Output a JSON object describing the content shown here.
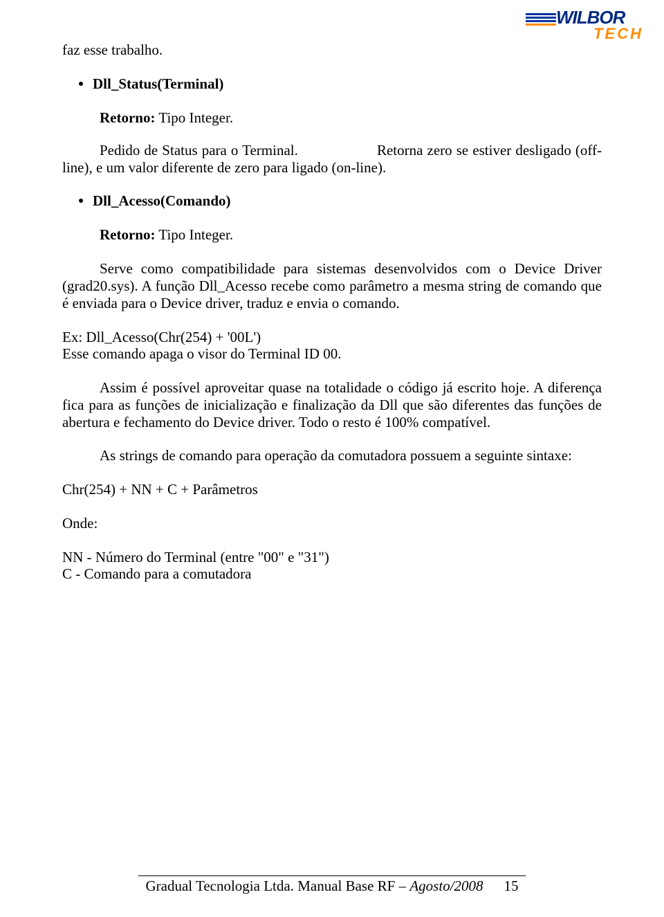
{
  "logo": {
    "brand": "WILBOR",
    "sub": "TECH"
  },
  "p_intro": "faz esse trabalho.",
  "item1": {
    "title": "Dll_Status(Terminal)",
    "retorno_label": "Retorno:",
    "retorno_val": " Tipo  Integer.",
    "desc1": "Pedido de Status para o Terminal.",
    "desc2": "Retorna zero se estiver desligado (off-line), e um valor diferente de zero para ligado (on-line)."
  },
  "item2": {
    "title": "Dll_Acesso(Comando)",
    "retorno_label": "Retorno:",
    "retorno_val": " Tipo  Integer.",
    "desc": "Serve como compatibilidade para sistemas desenvolvidos com o Device Driver (grad20.sys). A função Dll_Acesso recebe como parâmetro a mesma string de comando que é enviada para o Device driver, traduz e envia o comando."
  },
  "ex1": "Ex: Dll_Acesso(Chr(254) + '00L')",
  "ex2": "Esse comando apaga o visor do Terminal ID 00.",
  "p_assim": "Assim é possível aproveitar quase na totalidade o código já escrito hoje. A diferença fica para as funções de inicialização e finalização da Dll que são diferentes das funções de abertura e fechamento do Device driver. Todo o resto é 100% compatível.",
  "p_sintaxe": "As strings de comando para operação da comutadora possuem a seguinte sintaxe:",
  "p_chr": "Chr(254) + NN + C + Parâmetros",
  "p_onde": "Onde:",
  "p_nn": "NN - Número do Terminal (entre \"00\" e \"31\")",
  "p_c": "C - Comando para a comutadora",
  "footer": {
    "left": "Gradual Tecnologia Ltda. Manual Base RF – ",
    "ital": "Agosto/2008",
    "page": "15"
  }
}
